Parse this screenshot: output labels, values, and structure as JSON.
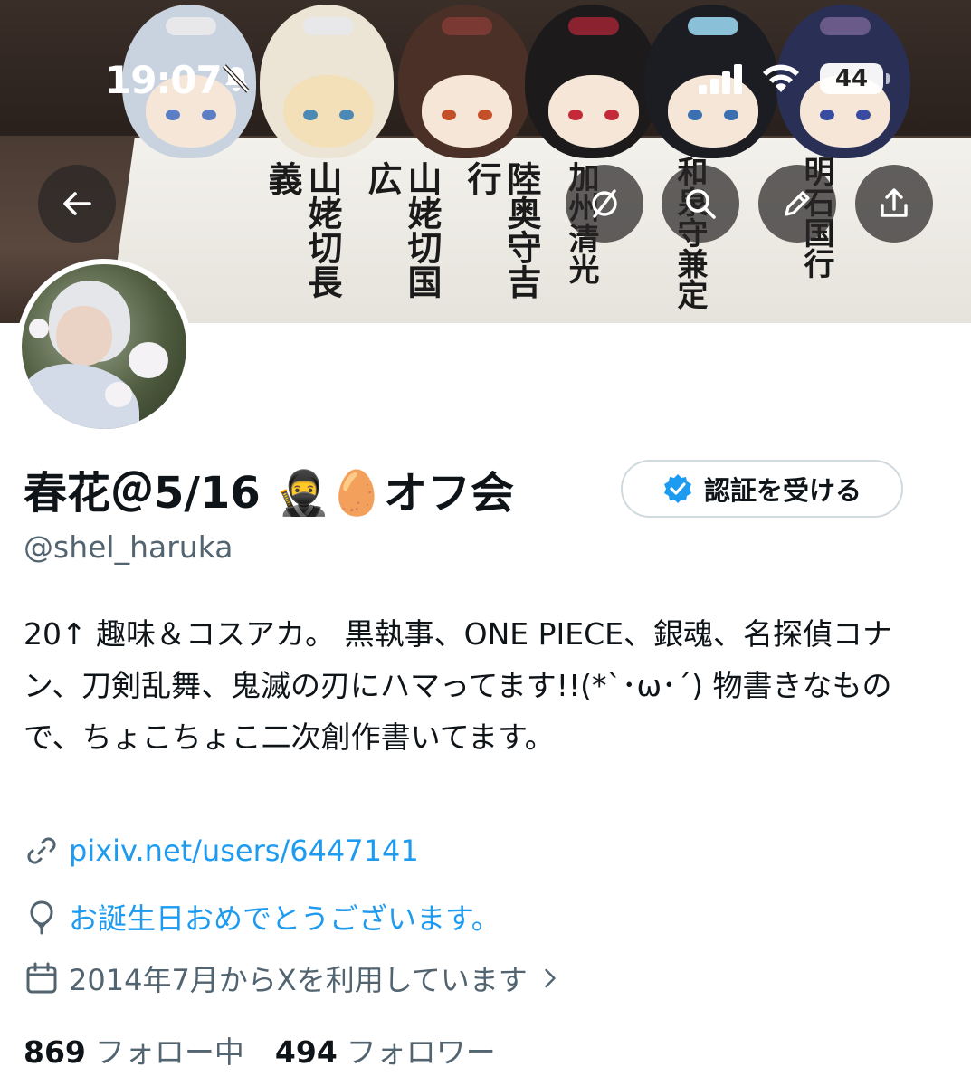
{
  "status_bar": {
    "time": "19:07",
    "battery": "44"
  },
  "banner": {
    "calligraphy_columns": [
      "山姥切長義",
      "山姥切国広",
      "陸奥守吉行",
      "加州清光",
      "和泉守兼定",
      "明石国行"
    ]
  },
  "nav": {
    "icons": [
      "back-arrow-icon",
      "grok-icon",
      "search-icon",
      "edit-pencil-icon",
      "share-icon"
    ]
  },
  "profile": {
    "display_name": "春花＠5/16 🥷🥚オフ会",
    "verify_button_label": "認証を受ける",
    "handle": "@shel_haruka",
    "bio": "20↑ 趣味＆コスアカ。 黒執事、ONE PIECE、銀魂、名探偵コナン、刀剣乱舞、鬼滅の刃にハマってます!!(*`･ω･´) 物書きなもので、ちょこちょこ二次創作書いてます。",
    "link": "pixiv.net/users/6447141",
    "birthday": "お誕生日おめでとうございます。",
    "joined": "2014年7月からXを利用しています",
    "following_count": "869",
    "following_label": "フォロー中",
    "followers_count": "494",
    "followers_label": "フォロワー"
  },
  "colors": {
    "accent": "#1d9bf0",
    "secondary_text": "#536471",
    "primary_text": "#0f1419"
  }
}
